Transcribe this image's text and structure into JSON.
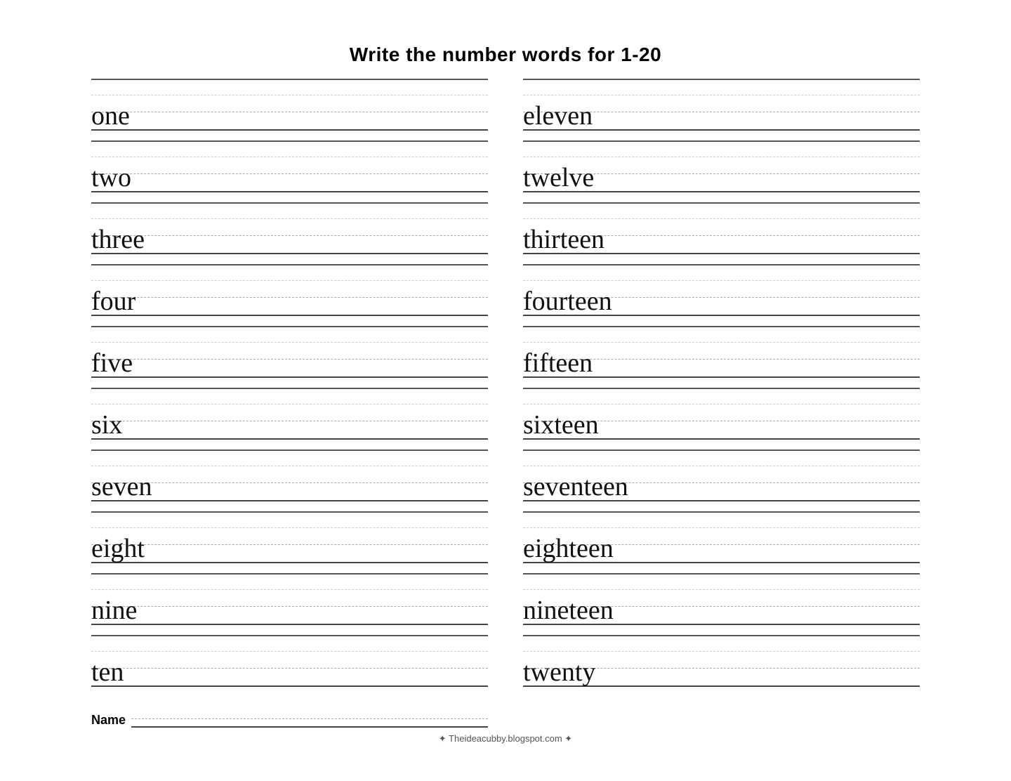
{
  "title": "Write the number words for  1-20",
  "left_column": [
    {
      "word": "one"
    },
    {
      "word": "two"
    },
    {
      "word": "three"
    },
    {
      "word": "four"
    },
    {
      "word": "five"
    },
    {
      "word": "six"
    },
    {
      "word": "seven"
    },
    {
      "word": "eight"
    },
    {
      "word": "nine"
    },
    {
      "word": "ten"
    }
  ],
  "right_column": [
    {
      "word": "eleven"
    },
    {
      "word": "twelve"
    },
    {
      "word": "thirteen"
    },
    {
      "word": "fourteen"
    },
    {
      "word": "fifteen"
    },
    {
      "word": "sixteen"
    },
    {
      "word": "seventeen"
    },
    {
      "word": "eighteen"
    },
    {
      "word": "nineteen"
    },
    {
      "word": "twenty"
    }
  ],
  "name_label": "Name",
  "footer": "✦ Theideacubby.blogspot.com ✦"
}
